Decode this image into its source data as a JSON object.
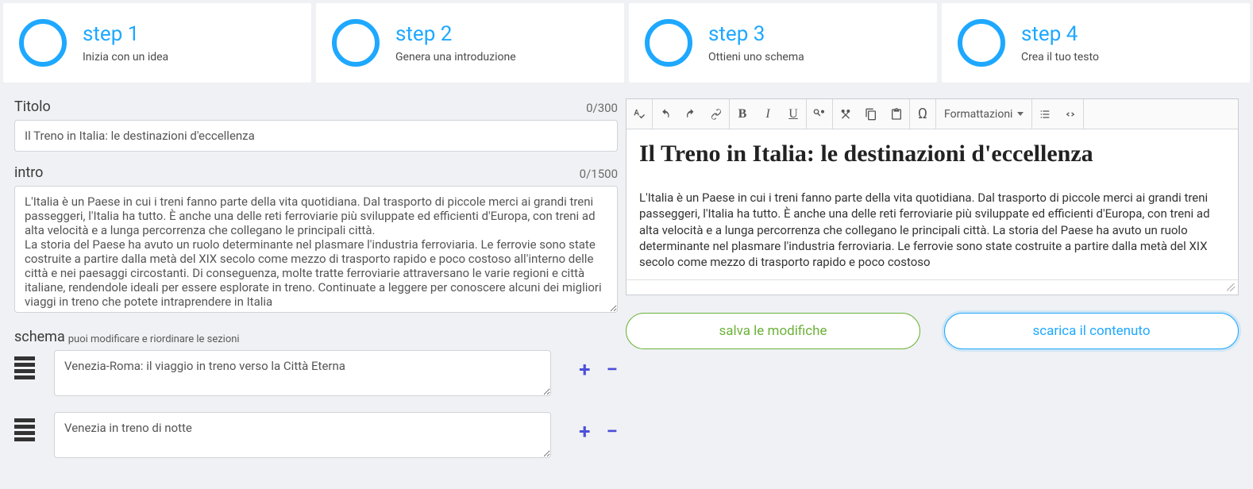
{
  "steps": [
    {
      "title": "step 1",
      "sub": "Inizia con un idea"
    },
    {
      "title": "step 2",
      "sub": "Genera una introduzione"
    },
    {
      "title": "step 3",
      "sub": "Ottieni uno schema"
    },
    {
      "title": "step 4",
      "sub": "Crea il tuo testo"
    }
  ],
  "titolo": {
    "label": "Titolo",
    "counter": "0/300",
    "value": "Il Treno in Italia: le destinazioni d'eccellenza"
  },
  "intro": {
    "label": "intro",
    "counter": "0/1500",
    "value": "L'Italia è un Paese in cui i treni fanno parte della vita quotidiana. Dal trasporto di piccole merci ai grandi treni passeggeri, l'Italia ha tutto. È anche una delle reti ferroviarie più sviluppate ed efficienti d'Europa, con treni ad alta velocità e a lunga percorrenza che collegano le principali città.\nLa storia del Paese ha avuto un ruolo determinante nel plasmare l'industria ferroviaria. Le ferrovie sono state costruite a partire dalla metà del XIX secolo come mezzo di trasporto rapido e poco costoso all'interno delle città e nei paesaggi circostanti. Di conseguenza, molte tratte ferroviarie attraversano le varie regioni e città italiane, rendendole ideali per essere esplorate in treno. Continuate a leggere per conoscere alcuni dei migliori viaggi in treno che potete intraprendere in Italia"
  },
  "schema": {
    "label": "schema",
    "hint": "puoi modificare e riordinare le sezioni",
    "items": [
      "Venezia-Roma: il viaggio in treno verso la Città Eterna",
      "Venezia in treno di notte"
    ]
  },
  "editor": {
    "heading": "Il Treno in Italia: le destinazioni d'eccellenza",
    "body": "L'Italia è un Paese in cui i treni fanno parte della vita quotidiana. Dal trasporto di piccole merci ai grandi treni passeggeri, l'Italia ha tutto. È anche una delle reti ferroviarie più sviluppate ed efficienti d'Europa, con treni ad alta velocità e a lunga percorrenza che collegano le principali città. La storia del Paese ha avuto un ruolo determinante nel plasmare l'industria ferroviaria. Le ferrovie sono state costruite a partire dalla metà del XIX secolo come mezzo di trasporto rapido e poco costoso",
    "format_label": "Formattazioni"
  },
  "buttons": {
    "save": "salva le modifiche",
    "download": "scarica il contenuto"
  }
}
